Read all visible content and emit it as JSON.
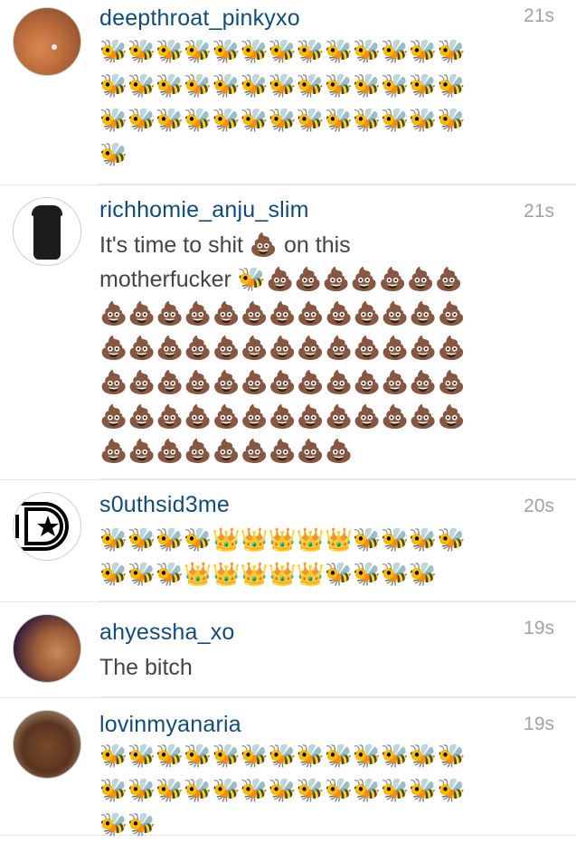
{
  "comments": [
    {
      "username": "deepthroat_pinkyxo",
      "time": "21s",
      "text": "",
      "emoji_rows": [
        "🐝🐝🐝🐝🐝🐝🐝🐝🐝🐝🐝🐝🐝",
        "🐝🐝🐝🐝🐝🐝🐝🐝🐝🐝🐝🐝🐝",
        "🐝🐝🐝🐝🐝🐝🐝🐝🐝🐝🐝🐝🐝",
        "🐝"
      ]
    },
    {
      "username": "richhomie_anju_slim",
      "time": "21s",
      "text_line1": "It's time to shit 💩 on this",
      "text_line2": "motherfucker 🐝💩💩💩💩💩💩💩",
      "emoji_rows": [
        "💩💩💩💩💩💩💩💩💩💩💩💩💩",
        "💩💩💩💩💩💩💩💩💩💩💩💩💩",
        "💩💩💩💩💩💩💩💩💩💩💩💩💩",
        "💩💩💩💩💩💩💩💩💩💩💩💩💩",
        "💩💩💩💩💩💩💩💩💩"
      ]
    },
    {
      "username": "s0uthsid3me",
      "time": "20s",
      "emoji_rows": [
        "🐝🐝🐝🐝👑👑👑👑👑🐝🐝🐝🐝",
        "🐝🐝🐝👑👑👑👑👑🐝🐝🐝🐝"
      ]
    },
    {
      "username": "ahyessha_xo",
      "time": "19s",
      "text": "The bitch"
    },
    {
      "username": "lovinmyanaria",
      "time": "19s",
      "emoji_rows": [
        "🐝🐝🐝🐝🐝🐝🐝🐝🐝🐝🐝🐝🐝",
        "🐝🐝🐝🐝🐝🐝🐝🐝🐝🐝🐝🐝🐝",
        "🐝🐝"
      ]
    }
  ]
}
